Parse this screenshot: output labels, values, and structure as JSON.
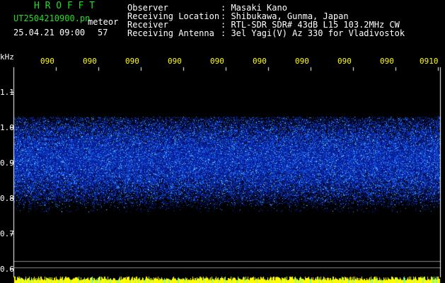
{
  "header": {
    "program": "H R O F F T",
    "filename": "UT2504210900.pn",
    "meteor_label": "meteor",
    "datetime": "25.04.21 09:00",
    "meteor_count": "57",
    "fields": [
      {
        "label": "Observer",
        "value": ": Masaki Kano"
      },
      {
        "label": "Receiving Location",
        "value": ": Shibukawa, Gunma, Japan"
      },
      {
        "label": "Receiver",
        "value": ": RTL-SDR SDR# 43dB L15 103.2MHz CW"
      },
      {
        "label": "Receiving Antenna",
        "value": ": 3el Yagi(V) Az 330 for Vladivostok"
      }
    ]
  },
  "spectrogram": {
    "y_unit": "kHz",
    "y_ticks": [
      "1.1",
      "1.0",
      "0.9",
      "0.8",
      "0.7",
      "0.6"
    ],
    "x_ticks": [
      "090",
      "090",
      "090",
      "090",
      "090",
      "090",
      "090",
      "090",
      "090",
      "0910"
    ],
    "colors": {
      "background": "#000000",
      "noise_low": "#0a1a8c",
      "noise_high": "#4aa0ff",
      "axis": "#ffffff",
      "bottom_bar": "#ffff00"
    }
  }
}
